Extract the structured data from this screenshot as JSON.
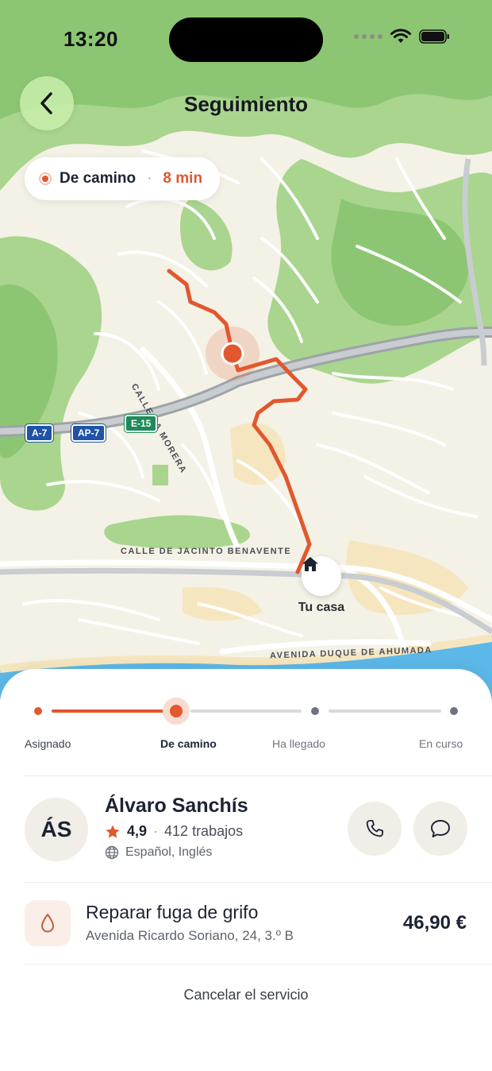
{
  "status_bar": {
    "time": "13:20"
  },
  "header": {
    "title": "Seguimiento",
    "back_icon": "chevron-left-icon"
  },
  "eta": {
    "status": "De camino",
    "separator": "·",
    "time": "8 min"
  },
  "map": {
    "destination_label": "Tu casa",
    "street_labels": [
      "CALLE LA MORERA",
      "CALLE DE JACINTO BENAVENTE",
      "AVENIDA DUQUE DE AHUMADA"
    ],
    "road_shields": [
      "A-7",
      "AP-7",
      "E-15"
    ],
    "route_color": "#e2572e"
  },
  "progress": {
    "current_index": 1,
    "steps": [
      {
        "label": "Asignado"
      },
      {
        "label": "De camino"
      },
      {
        "label": "Ha llegado"
      },
      {
        "label": "En curso"
      }
    ]
  },
  "professional": {
    "initials": "ÁS",
    "name": "Álvaro Sanchís",
    "rating": "4,9",
    "separator": "·",
    "jobs": "412 trabajos",
    "languages": "Español, Inglés"
  },
  "service": {
    "title": "Reparar fuga de grifo",
    "address": "Avenida Ricardo Soriano, 24, 3.º B",
    "price": "46,90 €",
    "icon": "water-drop-icon"
  },
  "actions": {
    "cancel_label": "Cancelar el servicio"
  },
  "colors": {
    "accent": "#e2572e",
    "accent_soft": "#f9dccf",
    "neutral_button": "#f1ede7"
  }
}
